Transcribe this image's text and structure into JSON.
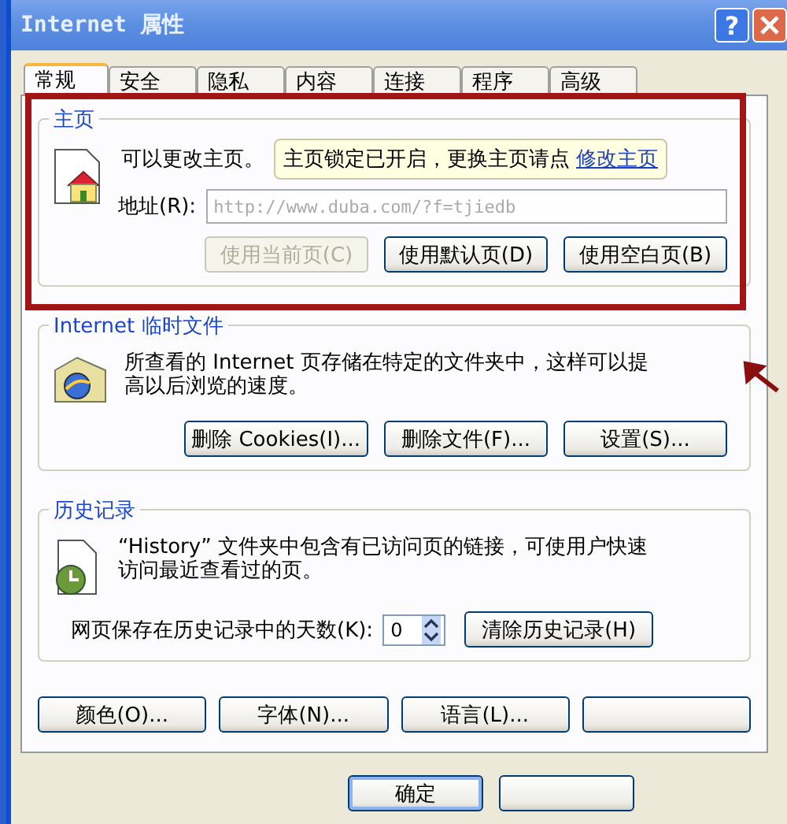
{
  "window": {
    "title": "Internet 属性",
    "help_button": "?"
  },
  "tabs": [
    {
      "label": "常规",
      "selected": true
    },
    {
      "label": "安全",
      "selected": false
    },
    {
      "label": "隐私",
      "selected": false
    },
    {
      "label": "内容",
      "selected": false
    },
    {
      "label": "连接",
      "selected": false
    },
    {
      "label": "程序",
      "selected": false
    },
    {
      "label": "高级",
      "selected": false
    }
  ],
  "homepage": {
    "title": "主页",
    "note": "可以更改主页。",
    "tooltip": {
      "text": "主页锁定已开启，更换主页请点",
      "link": "修改主页"
    },
    "address_label": "地址(R):",
    "address": "http://www.duba.com/?f=tjiedb",
    "address_disabled": true,
    "buttons": [
      {
        "label": "使用当前页(C)",
        "disabled": true
      },
      {
        "label": "使用默认页(D)",
        "disabled": false
      },
      {
        "label": "使用空白页(B)",
        "disabled": false
      }
    ]
  },
  "temp_files": {
    "title": "Internet 临时文件",
    "description": "所查看的 Internet 页存储在特定的文件夹中，这样可以提高以后浏览的速度。",
    "buttons": [
      "删除 Cookies(I)...",
      "删除文件(F)...",
      "设置(S)..."
    ]
  },
  "history": {
    "title": "历史记录",
    "description": "“History” 文件夹中包含有已访问页的链接，可使用户快速访问最近查看过的页。",
    "days_label": "网页保存在历史记录中的天数(K):",
    "days": "0",
    "clear_button": "清除历史记录(H)"
  },
  "bottom_buttons": [
    {
      "kind": "text",
      "label": "颜色(O)..."
    },
    {
      "kind": "text",
      "label": "字体(N)..."
    },
    {
      "kind": "text",
      "label": "语言(L)..."
    },
    {
      "kind": "blank"
    }
  ],
  "dialog_buttons": [
    {
      "kind": "text",
      "label": "确定",
      "default": true
    },
    {
      "kind": "blank",
      "default": false
    }
  ]
}
